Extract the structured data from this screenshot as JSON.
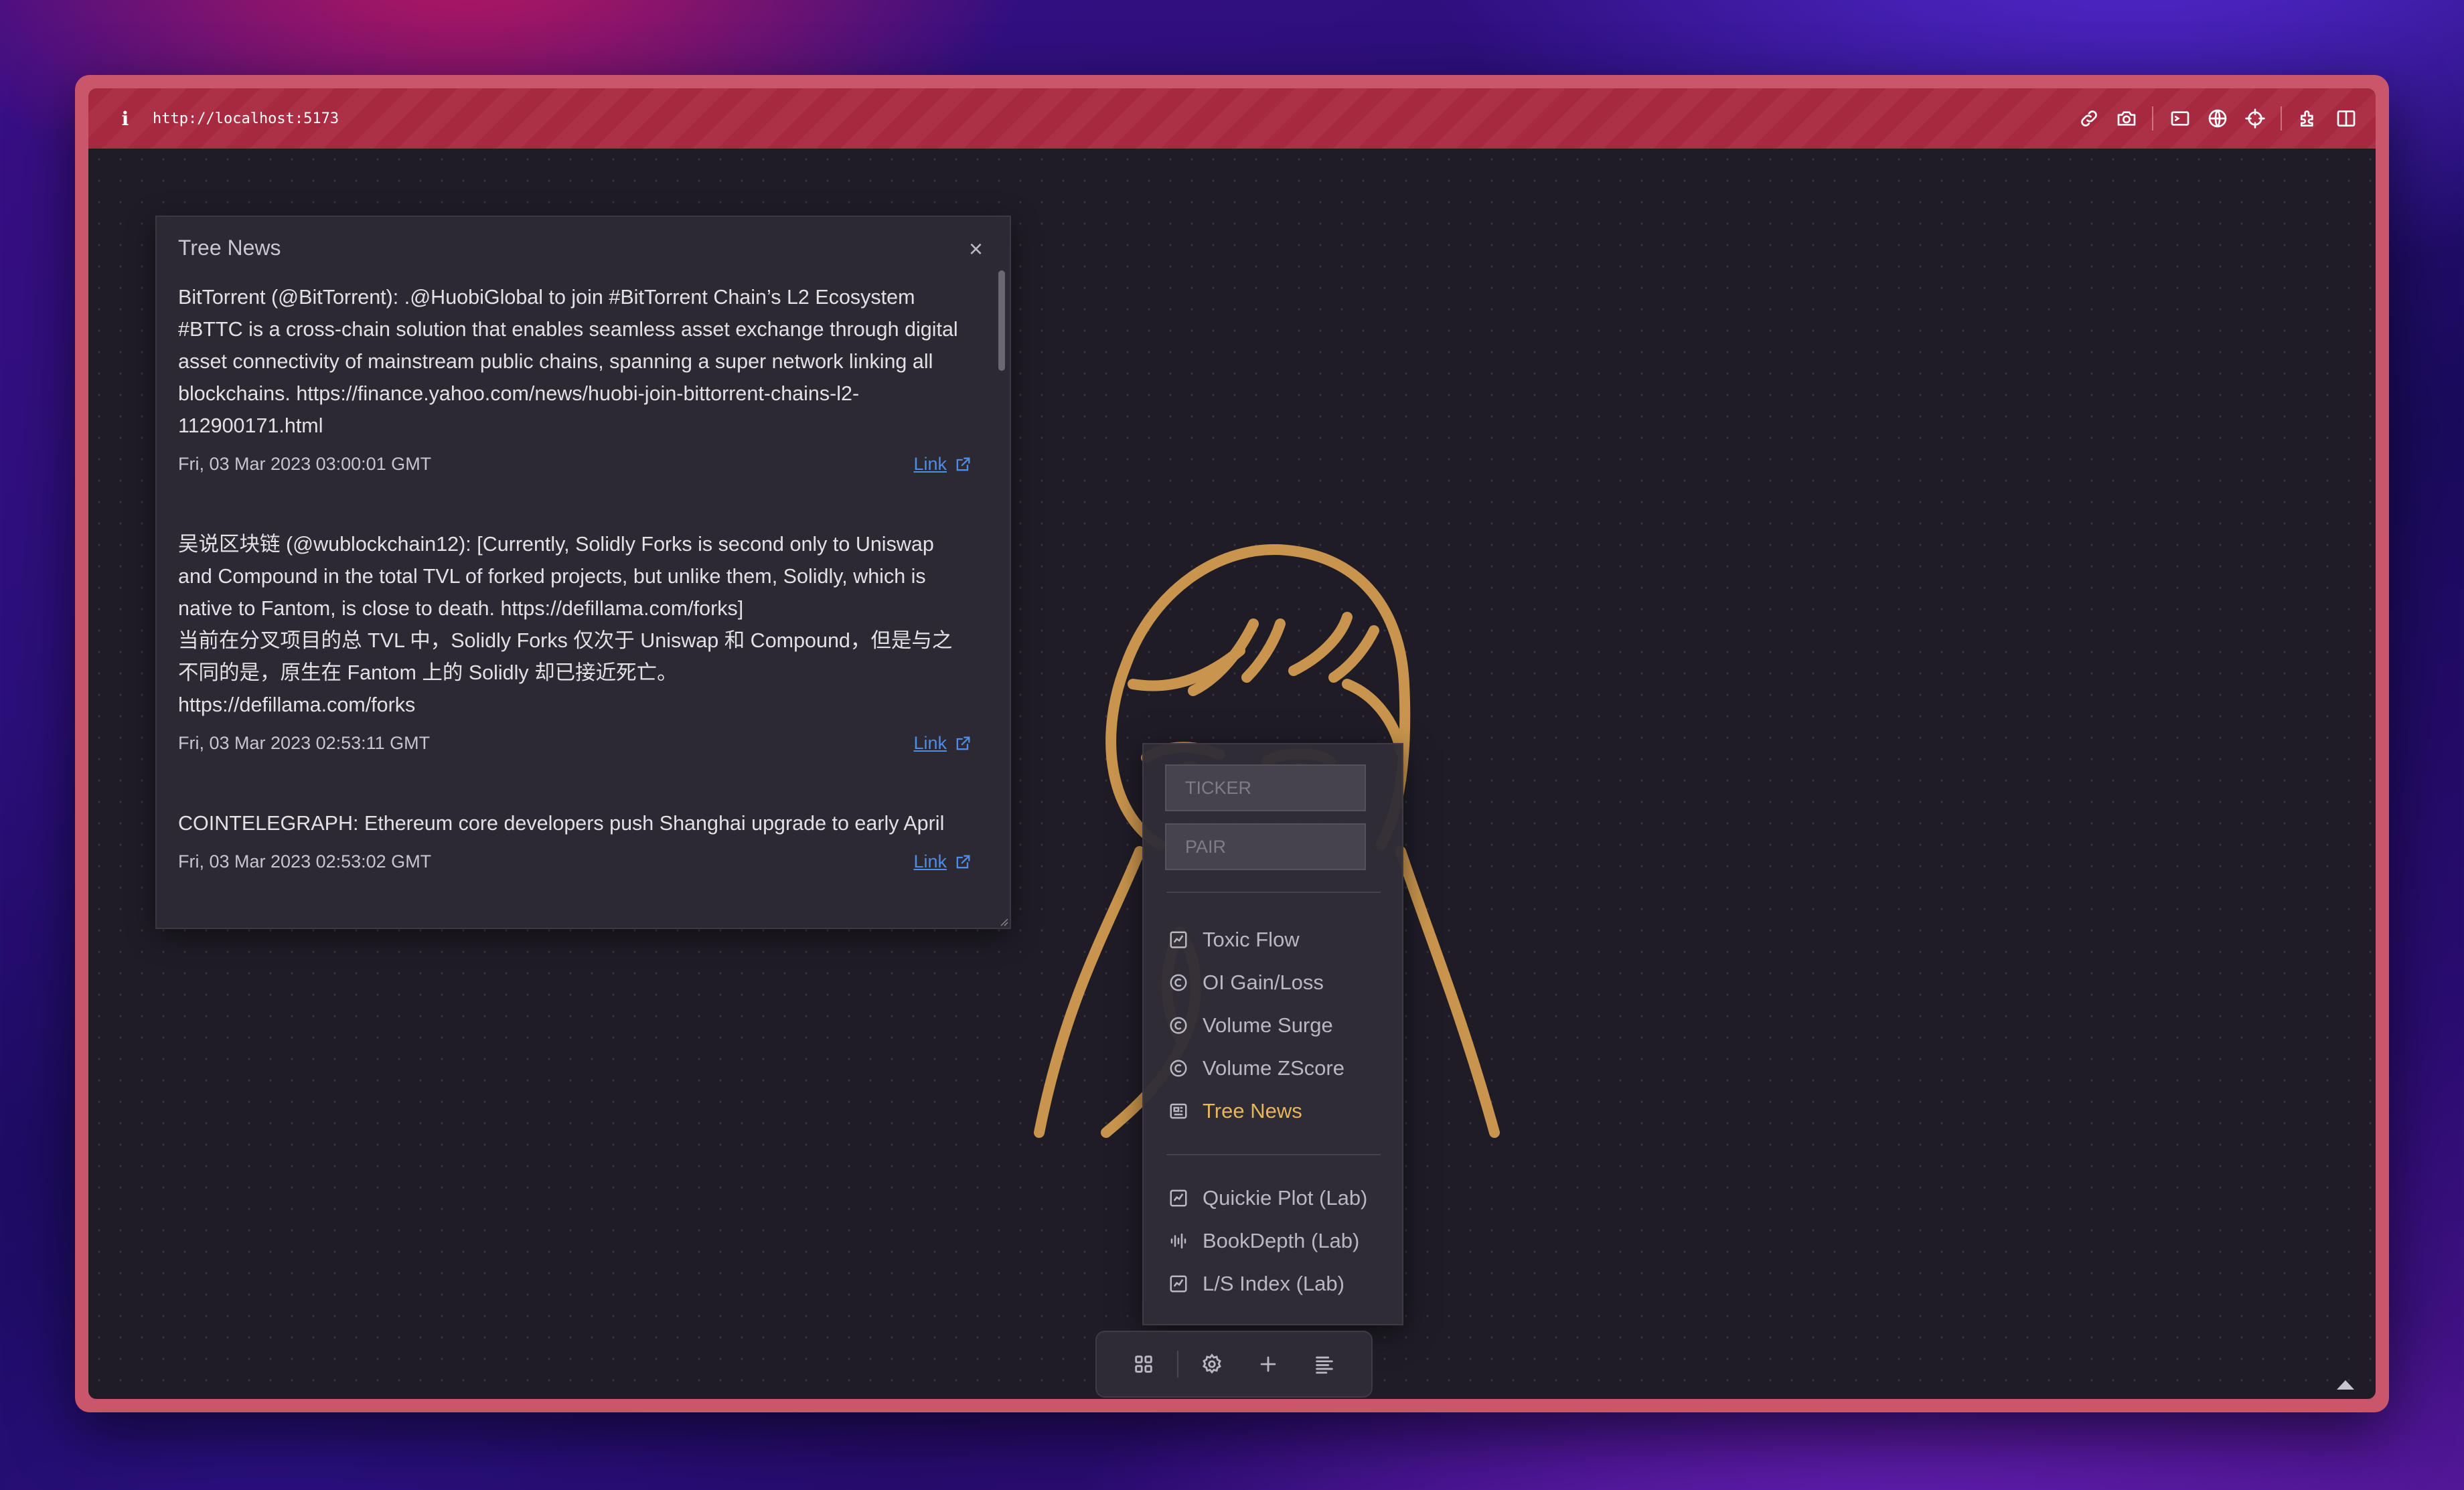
{
  "browser": {
    "url": "http://localhost:5173",
    "toolbar_icons": [
      "link-icon",
      "camera-icon",
      "terminal-icon",
      "globe-icon",
      "crosshair-icon",
      "extension-icon",
      "split-view-icon"
    ]
  },
  "news_panel": {
    "title": "Tree News",
    "items": [
      {
        "text": "BitTorrent (@BitTorrent): .@HuobiGlobal to join #BitTorrent Chain’s L2 Ecosystem\n#BTTC is a cross-chain solution that enables seamless asset exchange through digital asset connectivity of mainstream public chains, spanning a super network linking all blockchains. https://finance.yahoo.com/news/huobi-join-bittorrent-chains-l2-112900171.html",
        "date": "Fri, 03 Mar 2023 03:00:01 GMT",
        "link_label": "Link"
      },
      {
        "text": "吴说区块链 (@wublockchain12): [Currently, Solidly Forks is second only to Uniswap and Compound in the total TVL of forked projects, but unlike them, Solidly, which is native to Fantom, is close to death. https://defillama.com/forks]\n当前在分叉项目的总 TVL 中，Solidly Forks 仅次于 Uniswap 和 Compound，但是与之不同的是，原生在 Fantom 上的 Solidly 却已接近死亡。\nhttps://defillama.com/forks",
        "date": "Fri, 03 Mar 2023 02:53:11 GMT",
        "link_label": "Link"
      },
      {
        "text": "COINTELEGRAPH: Ethereum core developers push Shanghai upgrade to early April",
        "date": "Fri, 03 Mar 2023 02:53:02 GMT",
        "link_label": "Link"
      }
    ]
  },
  "widget_menu": {
    "ticker_placeholder": "TICKER",
    "pair_placeholder": "PAIR",
    "items": [
      {
        "label": "Toxic Flow",
        "icon": "chart-icon"
      },
      {
        "label": "OI Gain/Loss",
        "icon": "coin-icon"
      },
      {
        "label": "Volume Surge",
        "icon": "coin-icon"
      },
      {
        "label": "Volume ZScore",
        "icon": "coin-icon"
      },
      {
        "label": "Tree News",
        "icon": "newspaper-icon",
        "active": true
      }
    ],
    "lab_items": [
      {
        "label": "Quickie Plot (Lab)",
        "icon": "chart-icon"
      },
      {
        "label": "BookDepth (Lab)",
        "icon": "depth-bars-icon"
      },
      {
        "label": "L/S Index (Lab)",
        "icon": "chart-icon"
      }
    ]
  },
  "bottom_toolbar": {
    "buttons": [
      "grid-icon",
      "gear-icon",
      "plus-icon",
      "align-left-icon"
    ]
  },
  "colors": {
    "accent": "#e8b55c",
    "window_frame": "#c9566a",
    "titlebar": "#a6293f",
    "canvas": "#1f1c26",
    "link": "#4d8de6"
  }
}
